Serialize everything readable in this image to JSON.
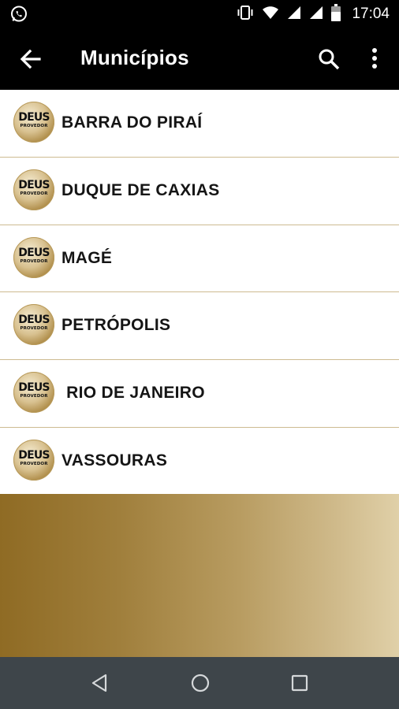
{
  "status_bar": {
    "time": "17:04",
    "icons": [
      "whatsapp-icon",
      "vibrate-icon",
      "wifi-icon",
      "signal-icon",
      "signal-icon",
      "battery-icon"
    ]
  },
  "app_bar": {
    "title": "Municípios",
    "icons": [
      "back-arrow-icon",
      "search-icon",
      "more-vert-icon"
    ]
  },
  "list": {
    "logo_text": "DEUS",
    "logo_subtext": "PROVEDOR",
    "items": [
      {
        "label": "BARRA DO PIRAÍ"
      },
      {
        "label": "DUQUE DE CAXIAS"
      },
      {
        "label": "MAGÉ"
      },
      {
        "label": "PETRÓPOLIS"
      },
      {
        "label": " RIO DE JANEIRO"
      },
      {
        "label": "VASSOURAS"
      }
    ]
  },
  "nav_bar": {
    "icons": [
      "back-triangle-icon",
      "home-circle-icon",
      "recents-square-icon"
    ]
  },
  "colors": {
    "app_bar": "#000000",
    "divider": "#cdbb91",
    "gold_start": "#8f6b24",
    "gold_end": "#e0d0a8",
    "nav_bar": "#3e454a"
  }
}
